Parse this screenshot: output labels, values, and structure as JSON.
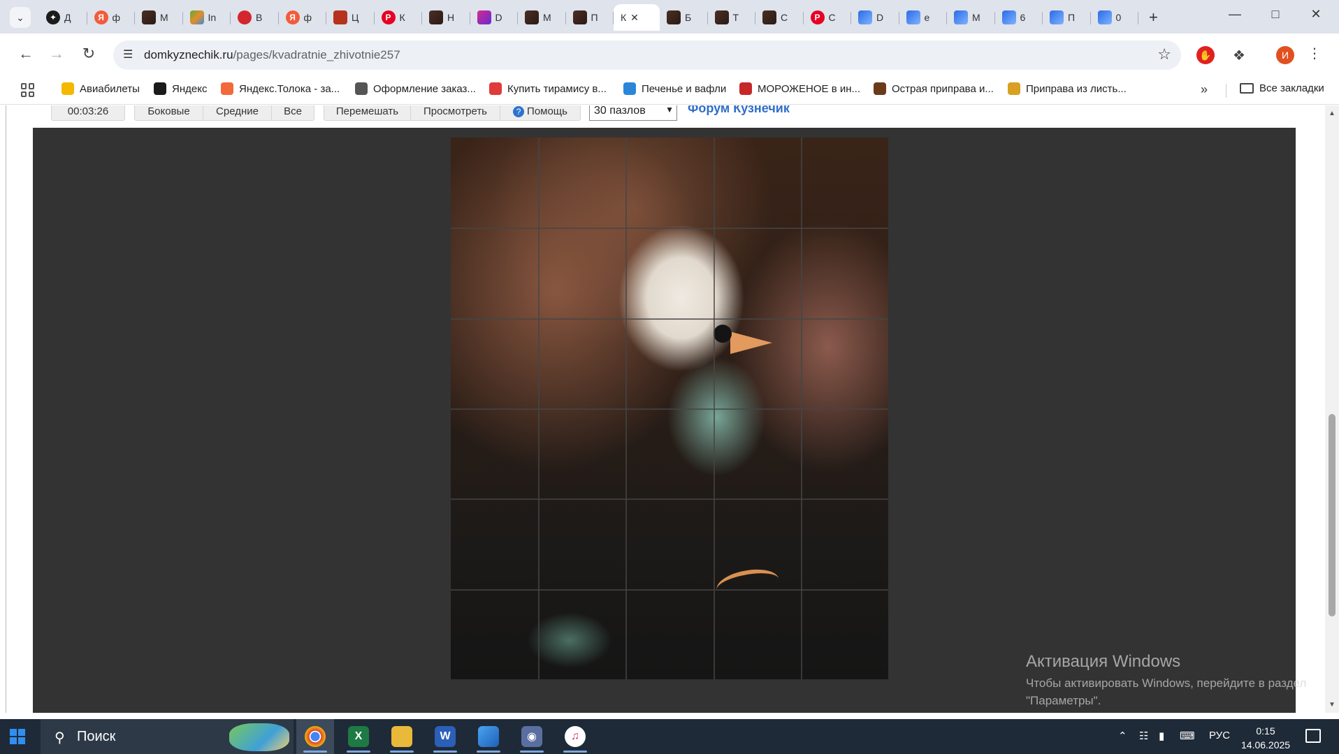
{
  "browser": {
    "tabs": [
      {
        "label": "Д",
        "icon": "black-star-icon"
      },
      {
        "label": "ф",
        "icon": "yandex-icon"
      },
      {
        "label": "М",
        "icon": "photo-icon"
      },
      {
        "label": "In",
        "icon": "mosaic-icon"
      },
      {
        "label": "В",
        "icon": "red-circle-icon"
      },
      {
        "label": "ф",
        "icon": "yandex-icon"
      },
      {
        "label": "Ц",
        "icon": "red-box-icon"
      },
      {
        "label": "К",
        "icon": "pinterest-icon"
      },
      {
        "label": "Н",
        "icon": "photo-icon"
      },
      {
        "label": "D",
        "icon": "galaxy-icon"
      },
      {
        "label": "М",
        "icon": "photo-icon"
      },
      {
        "label": "П",
        "icon": "photo-icon"
      },
      {
        "label": "К",
        "icon": "domkyznechik-icon",
        "active": true
      },
      {
        "label": "Б",
        "icon": "photo-icon"
      },
      {
        "label": "Т",
        "icon": "photo-icon"
      },
      {
        "label": "С",
        "icon": "photo-icon"
      },
      {
        "label": "С",
        "icon": "pinterest-icon"
      },
      {
        "label": "D",
        "icon": "blue-tab-icon"
      },
      {
        "label": "e",
        "icon": "blue-tab-icon"
      },
      {
        "label": "М",
        "icon": "blue-tab-icon"
      },
      {
        "label": "6",
        "icon": "blue-tab-icon"
      },
      {
        "label": "П",
        "icon": "blue-tab-icon"
      },
      {
        "label": "0",
        "icon": "blue-tab-icon"
      }
    ],
    "url_domain": "domkyznechik.ru",
    "url_path": "/pages/kvadratnie_zhivotnie257",
    "bookmarks": [
      {
        "label": "Авиабилеты",
        "color": "#f5b800"
      },
      {
        "label": "Яндекс",
        "color": "#1b1b1b"
      },
      {
        "label": "Яндекс.Толока - за...",
        "color": "#f26a3a"
      },
      {
        "label": "Оформление заказ...",
        "color": "#555555"
      },
      {
        "label": "Купить тирамису в...",
        "color": "#e03a3a"
      },
      {
        "label": "Печенье и вафли",
        "color": "#2a86d8"
      },
      {
        "label": "МОРОЖЕНОЕ в ин...",
        "color": "#c62828"
      },
      {
        "label": "Острая приправа и...",
        "color": "#6b3a1a"
      },
      {
        "label": "Приправа из листь...",
        "color": "#d9a021"
      }
    ],
    "bookmarks_folder": "Все закладки",
    "profile_letter": "И"
  },
  "puzzle_page": {
    "timer": "00:03:26",
    "filter_buttons": [
      "Боковые",
      "Средние",
      "Все"
    ],
    "action_buttons": [
      "Перемешать",
      "Просмотреть",
      "Помощь"
    ],
    "pieces_select": "30 пазлов",
    "forum_link": "Форум Кузнечик",
    "grid": {
      "columns": 5,
      "rows": 6
    }
  },
  "activation": {
    "title": "Активация Windows",
    "line1": "Чтобы активировать Windows, перейдите в раздел",
    "line2": "\"Параметры\"."
  },
  "taskbar": {
    "search_label": "Поиск",
    "apps": [
      "chrome-icon",
      "excel-icon",
      "explorer-icon",
      "word-icon",
      "photos-icon",
      "camera-icon",
      "itunes-icon"
    ],
    "language": "РУС",
    "time": "0:15",
    "date": "14.06.2025"
  }
}
